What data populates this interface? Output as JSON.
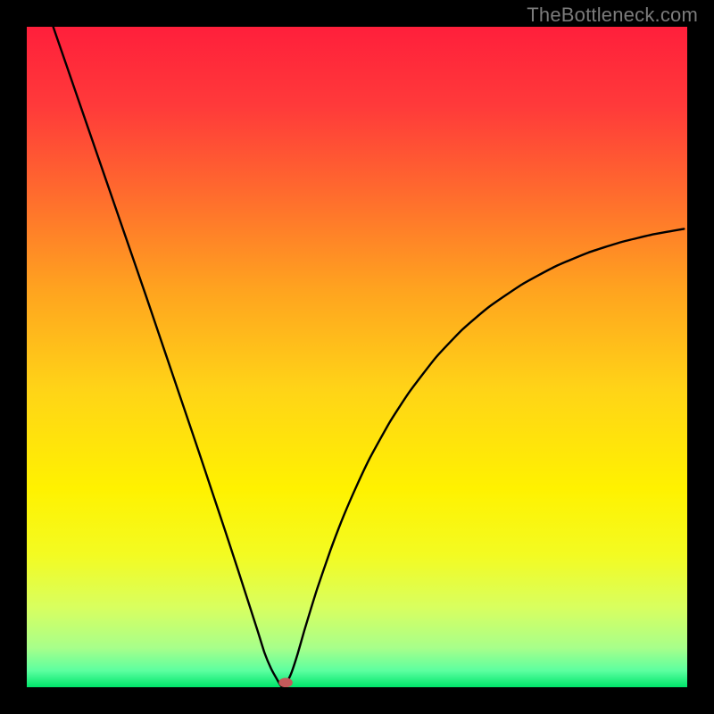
{
  "watermark": "TheBottleneck.com",
  "chart_data": {
    "type": "line",
    "title": "",
    "xlabel": "",
    "ylabel": "",
    "xlim": [
      0,
      100
    ],
    "ylim": [
      0,
      100
    ],
    "grid": false,
    "background_gradient_stops": [
      {
        "offset": 0.0,
        "color": "#ff1f3b"
      },
      {
        "offset": 0.12,
        "color": "#ff3a3a"
      },
      {
        "offset": 0.25,
        "color": "#ff6a2e"
      },
      {
        "offset": 0.4,
        "color": "#ffa41f"
      },
      {
        "offset": 0.55,
        "color": "#ffd417"
      },
      {
        "offset": 0.7,
        "color": "#fff200"
      },
      {
        "offset": 0.8,
        "color": "#f3fb22"
      },
      {
        "offset": 0.88,
        "color": "#d8ff60"
      },
      {
        "offset": 0.94,
        "color": "#a8ff8a"
      },
      {
        "offset": 0.975,
        "color": "#5cffa0"
      },
      {
        "offset": 1.0,
        "color": "#00e56a"
      }
    ],
    "series": [
      {
        "name": "bottleneck-curve",
        "x": [
          4,
          6,
          8,
          10,
          12,
          14,
          16,
          18,
          20,
          22,
          24,
          26,
          28,
          30,
          32,
          34,
          35,
          36,
          37,
          38,
          38.5,
          39,
          40,
          41,
          42,
          43,
          44,
          46,
          48,
          50,
          52,
          55,
          58,
          62,
          66,
          70,
          75,
          80,
          85,
          90,
          95,
          99.5
        ],
        "y": [
          100,
          94.2,
          88.4,
          82.6,
          76.8,
          71.0,
          65.2,
          59.4,
          53.5,
          47.6,
          41.7,
          35.8,
          29.8,
          23.8,
          17.7,
          11.5,
          8.4,
          5.2,
          2.8,
          1.0,
          0.2,
          0.0,
          2.0,
          5.0,
          8.5,
          11.8,
          15.0,
          20.8,
          26.0,
          30.6,
          34.8,
          40.2,
          44.8,
          50.0,
          54.2,
          57.6,
          61.0,
          63.7,
          65.8,
          67.4,
          68.6,
          69.4
        ]
      }
    ],
    "marker": {
      "name": "target-point",
      "x": 39.2,
      "y": 0.7,
      "color": "#c45a5a",
      "rx": 1.05,
      "ry": 0.72
    }
  }
}
